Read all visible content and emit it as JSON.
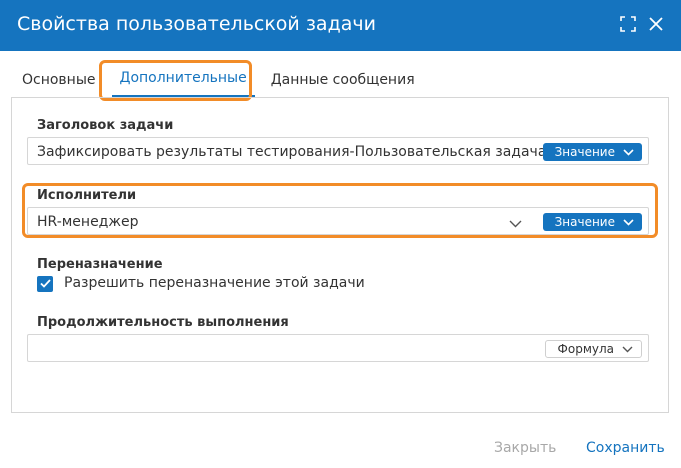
{
  "dialog": {
    "title": "Свойства пользовательской задачи",
    "icons": [
      "expand-icon",
      "close-icon"
    ]
  },
  "tabs": [
    {
      "label": "Основные",
      "active": false
    },
    {
      "label": "Дополнительные",
      "active": true
    },
    {
      "label": "Данные сообщения",
      "active": false
    }
  ],
  "fields": {
    "task_title": {
      "label": "Заголовок задачи",
      "value": "Зафиксировать результаты тестирования-Пользовательская задача",
      "mode": "Значение"
    },
    "assignees": {
      "label": "Исполнители",
      "value": "HR-менеджер",
      "mode": "Значение"
    },
    "reassignment": {
      "label": "Переназначение",
      "checkbox_label": "Разрешить переназначение этой задачи",
      "checked": true
    },
    "duration": {
      "label": "Продолжительность выполнения",
      "value": "",
      "mode": "Формула"
    }
  },
  "footer": {
    "close_label": "Закрыть",
    "save_label": "Сохранить"
  },
  "colors": {
    "accent": "#1574bf",
    "highlight": "#f28c28",
    "disabled_text": "#a8a8a8"
  }
}
